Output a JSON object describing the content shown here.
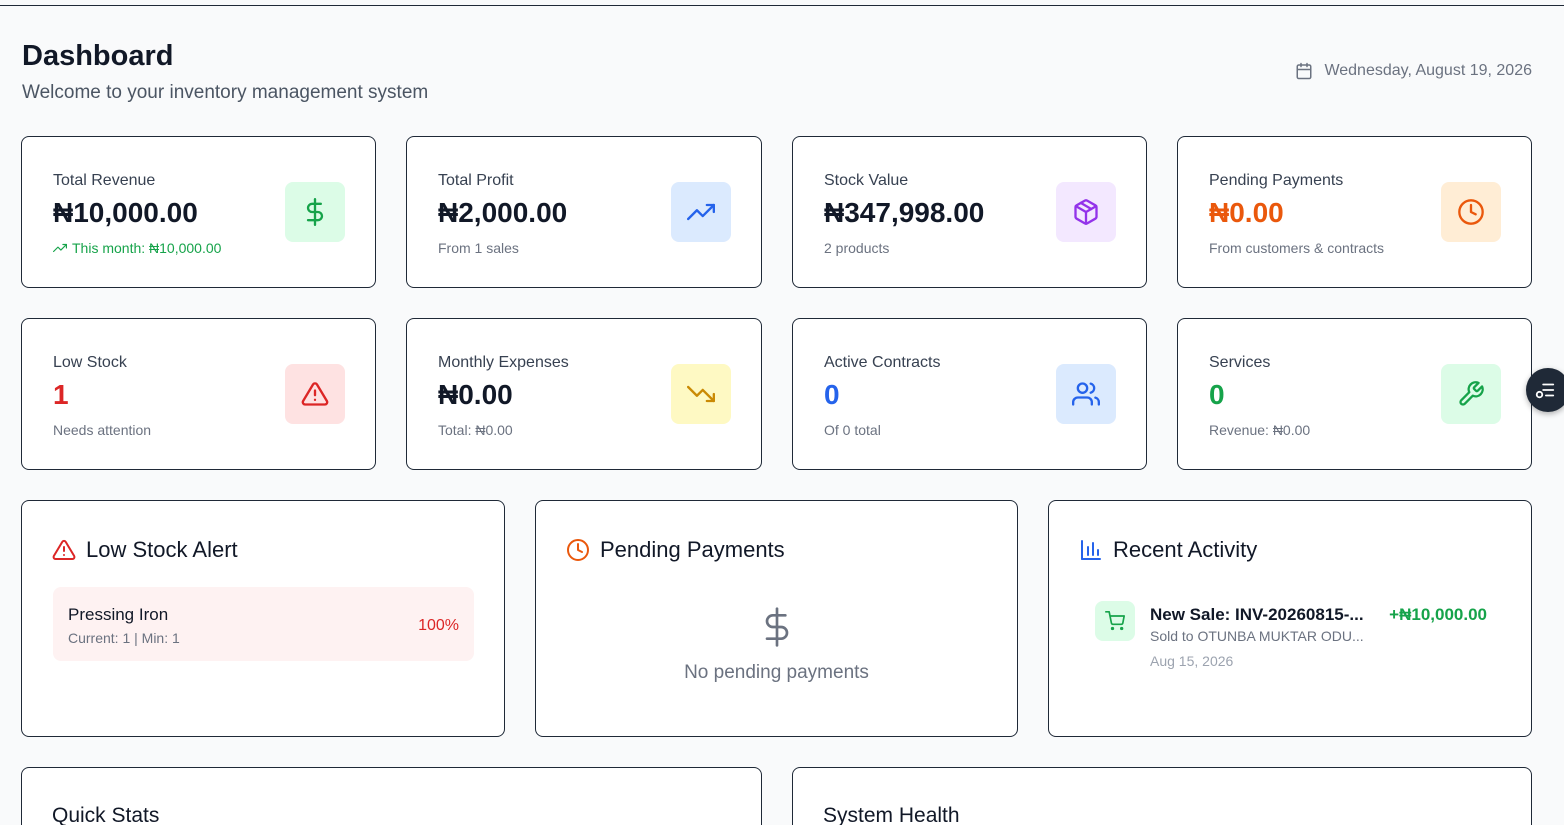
{
  "header": {
    "title": "Dashboard",
    "subtitle": "Welcome to your inventory management system",
    "date": "Wednesday, August 19, 2026"
  },
  "stats": [
    {
      "label": "Total Revenue",
      "value": "₦10,000.00",
      "sub": "This month: ₦10,000.00",
      "value_color": "#111827",
      "sub_color": "#16a34a",
      "icon": "dollar-icon",
      "icon_bg": "#dcfce7",
      "icon_color": "#16a34a"
    },
    {
      "label": "Total Profit",
      "value": "₦2,000.00",
      "sub": "From 1 sales",
      "value_color": "#111827",
      "sub_color": "#6b7280",
      "icon": "trending-up-icon",
      "icon_bg": "#dbeafe",
      "icon_color": "#2563eb"
    },
    {
      "label": "Stock Value",
      "value": "₦347,998.00",
      "sub": "2 products",
      "value_color": "#111827",
      "sub_color": "#6b7280",
      "icon": "package-icon",
      "icon_bg": "#f3e8ff",
      "icon_color": "#9333ea"
    },
    {
      "label": "Pending Payments",
      "value": "₦0.00",
      "sub": "From customers & contracts",
      "value_color": "#ea580c",
      "sub_color": "#6b7280",
      "icon": "clock-icon",
      "icon_bg": "#ffedd5",
      "icon_color": "#ea580c"
    },
    {
      "label": "Low Stock",
      "value": "1",
      "sub": "Needs attention",
      "value_color": "#dc2626",
      "sub_color": "#6b7280",
      "icon": "alert-triangle-icon",
      "icon_bg": "#fee2e2",
      "icon_color": "#dc2626"
    },
    {
      "label": "Monthly Expenses",
      "value": "₦0.00",
      "sub": "Total: ₦0.00",
      "value_color": "#111827",
      "sub_color": "#6b7280",
      "icon": "trending-down-icon",
      "icon_bg": "#fef9c3",
      "icon_color": "#ca8a04"
    },
    {
      "label": "Active Contracts",
      "value": "0",
      "sub": "Of 0 total",
      "value_color": "#2563eb",
      "sub_color": "#6b7280",
      "icon": "users-icon",
      "icon_bg": "#dbeafe",
      "icon_color": "#2563eb"
    },
    {
      "label": "Services",
      "value": "0",
      "sub": "Revenue: ₦0.00",
      "value_color": "#16a34a",
      "sub_color": "#6b7280",
      "icon": "wrench-icon",
      "icon_bg": "#dcfce7",
      "icon_color": "#16a34a"
    }
  ],
  "low_stock_alert": {
    "title": "Low Stock Alert",
    "items": [
      {
        "name": "Pressing Iron",
        "meta": "Current: 1 | Min: 1",
        "percent": "100%"
      }
    ]
  },
  "pending_payments": {
    "title": "Pending Payments",
    "empty_text": "No pending payments"
  },
  "recent_activity": {
    "title": "Recent Activity",
    "items": [
      {
        "title": "New Sale: INV-20260815-...",
        "desc": "Sold to OTUNBA MUKTAR ODU...",
        "date": "Aug 15, 2026",
        "amount": "+₦10,000.00"
      }
    ]
  },
  "quick_stats": {
    "title": "Quick Stats"
  },
  "system_health": {
    "title": "System Health"
  },
  "colors": {
    "accent": "#2563eb",
    "danger": "#dc2626",
    "warning": "#ea580c",
    "success": "#16a34a"
  }
}
